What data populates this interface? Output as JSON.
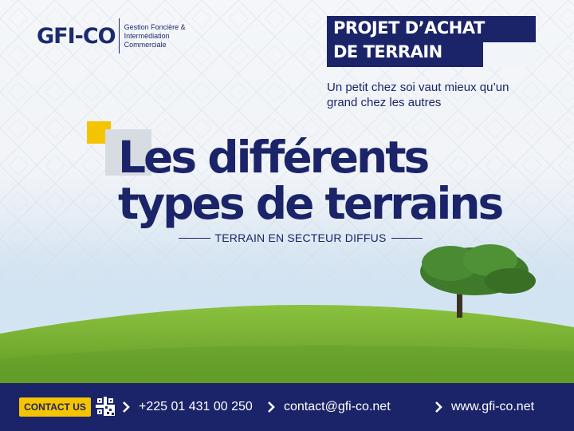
{
  "logo": {
    "mark": "GFI-CO",
    "text": "Gestion Foncière & Intermédiation Commerciale"
  },
  "badge": {
    "line1": "PROJET D’ACHAT",
    "line2": "DE TERRAIN"
  },
  "tagline": "Un petit chez soi vaut mieux qu’un grand chez les autres",
  "headline": {
    "line1": "Les différents",
    "line2": "types de terrains"
  },
  "subtitle": "TERRAIN EN SECTEUR DIFFUS",
  "footer": {
    "contact_label": "CONTACT US",
    "phone": "+225 01 431 00 250",
    "email": "contact@gfi-co.net",
    "website": "www.gfi-co.net"
  },
  "colors": {
    "navy": "#1b2468",
    "yellow": "#f5c400",
    "grass": "#6fa82e"
  },
  "icons": [
    "qr-code-icon",
    "chevron-right-icon",
    "tree-illustration"
  ]
}
